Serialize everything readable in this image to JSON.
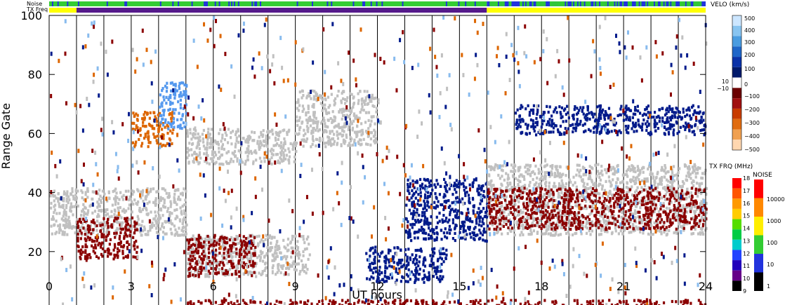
{
  "chart_data": {
    "type": "heatmap",
    "xlabel": "UT hours",
    "ylabel": "Range Gate",
    "xlim": [
      0,
      24
    ],
    "ylim": [
      0,
      100
    ],
    "x_ticks": [
      "0",
      "3",
      "6",
      "9",
      "12",
      "15",
      "18",
      "21",
      "24"
    ],
    "y_ticks": [
      "0",
      "20",
      "40",
      "60",
      "80",
      "100"
    ],
    "grid": "vertical lines at each UT hour",
    "top_strips": [
      {
        "label": "Noise",
        "description": "green with blue segments; mostly blue after 16 UT",
        "segments": [
          {
            "x0": 0,
            "x1": 16,
            "color": "#33cc33"
          },
          {
            "x0": 16,
            "x1": 24,
            "color": "#2233dd"
          }
        ]
      },
      {
        "label": "TX Freq",
        "segments": [
          {
            "x0": 0,
            "x1": 1,
            "color": "#ffff00"
          },
          {
            "x0": 1,
            "x1": 16,
            "color": "#551a8b"
          },
          {
            "x0": 16,
            "x1": 24,
            "color": "#ffff00"
          }
        ]
      }
    ],
    "scatter_regions": [
      {
        "x": [
          0,
          5
        ],
        "y": [
          26,
          42
        ],
        "color": "#c0c0c0"
      },
      {
        "x": [
          1,
          3.2
        ],
        "y": [
          18,
          32
        ],
        "color": "#8b0000"
      },
      {
        "x": [
          5,
          9.5
        ],
        "y": [
          12,
          26
        ],
        "color": "#c0c0c0"
      },
      {
        "x": [
          5,
          7.5
        ],
        "y": [
          12,
          26
        ],
        "color": "#8b0000"
      },
      {
        "x": [
          5,
          9
        ],
        "y": [
          50,
          62
        ],
        "color": "#c0c0c0"
      },
      {
        "x": [
          9,
          12
        ],
        "y": [
          56,
          75
        ],
        "color": "#c0c0c0"
      },
      {
        "x": [
          13,
          16
        ],
        "y": [
          24,
          45
        ],
        "color": "#001a8b"
      },
      {
        "x": [
          11.5,
          14.5
        ],
        "y": [
          10,
          22
        ],
        "color": "#001a8b"
      },
      {
        "x": [
          16,
          24
        ],
        "y": [
          26,
          50
        ],
        "color": "#c0c0c0"
      },
      {
        "x": [
          16,
          24
        ],
        "y": [
          28,
          42
        ],
        "color": "#8b0000"
      },
      {
        "x": [
          3,
          4.5
        ],
        "y": [
          56,
          68
        ],
        "color": "#dd6600"
      },
      {
        "x": [
          4,
          5
        ],
        "y": [
          62,
          78
        ],
        "color": "#5599ee"
      },
      {
        "x": [
          5,
          24
        ],
        "y": [
          0,
          4
        ],
        "color": "#8b0000"
      },
      {
        "x": [
          17,
          24
        ],
        "y": [
          60,
          70
        ],
        "color": "#001a8b"
      }
    ],
    "colorbars": [
      {
        "title": "VELO (km/s)",
        "ticks": [
          "500",
          "400",
          "300",
          "200",
          "100",
          "10",
          "0",
          "−10",
          "−100",
          "−200",
          "−300",
          "−400",
          "−500"
        ]
      },
      {
        "title": "TX FRQ (MHz)",
        "ticks": [
          "18",
          "17",
          "16",
          "15",
          "14",
          "13",
          "12",
          "11",
          "10",
          "9"
        ]
      },
      {
        "title": "NOISE",
        "ticks": [
          "10000",
          "1000",
          "100",
          "10",
          "1"
        ]
      }
    ]
  }
}
